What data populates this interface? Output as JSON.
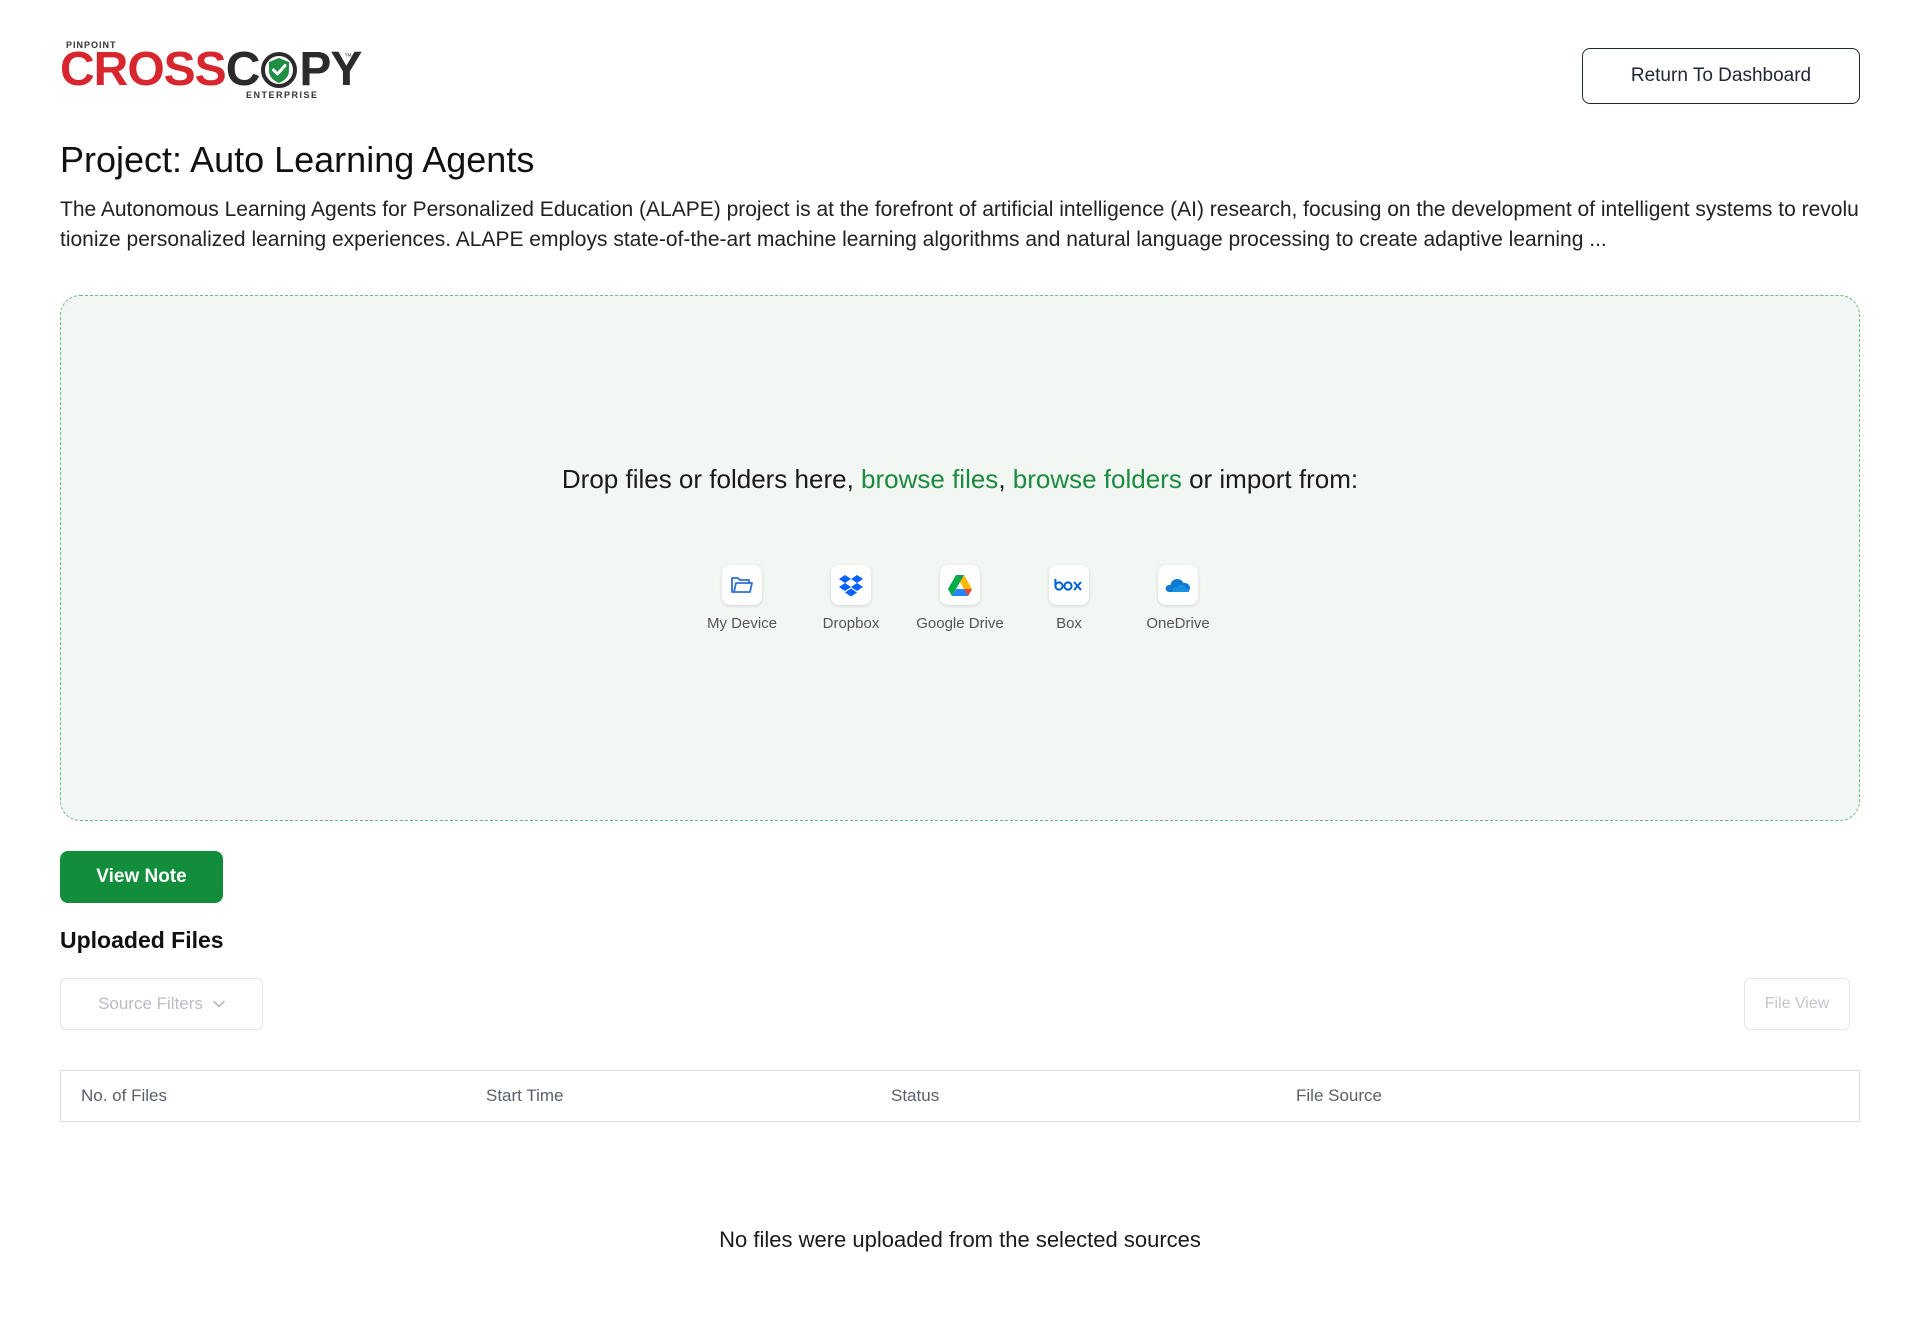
{
  "logo": {
    "top_text": "PINPOINT",
    "cross": "CROSS",
    "c": "C",
    "py": "PY",
    "bottom_text": "ENTERPRISE",
    "tm": "™"
  },
  "header": {
    "return_label": "Return To Dashboard"
  },
  "project": {
    "title": "Project: Auto Learning Agents",
    "description": "The Autonomous Learning Agents for Personalized Education (ALAPE) project is at the forefront of artificial intelligence (AI) research, focusing on the development of intelligent systems to revolutionize personalized learning experiences. ALAPE employs state-of-the-art machine learning algorithms and natural language processing to create adaptive learning ..."
  },
  "dropzone": {
    "text_before": "Drop files or folders here, ",
    "browse_files": "browse files",
    "comma": ", ",
    "browse_folders": "browse folders",
    "text_after": " or import from:",
    "sources": [
      {
        "label": "My Device",
        "icon": "folder-icon"
      },
      {
        "label": "Dropbox",
        "icon": "dropbox-icon"
      },
      {
        "label": "Google Drive",
        "icon": "google-drive-icon"
      },
      {
        "label": "Box",
        "icon": "box-icon"
      },
      {
        "label": "OneDrive",
        "icon": "onedrive-icon"
      }
    ]
  },
  "view_note_label": "View Note",
  "uploaded": {
    "title": "Uploaded Files",
    "source_filters_label": "Source Filters",
    "file_view_label": "File View",
    "columns": [
      "No. of Files",
      "Start Time",
      "Status",
      "File Source"
    ],
    "empty_message": "No files were uploaded from the selected sources"
  },
  "colors": {
    "accent_green": "#128d3c",
    "link_green": "#1c8a3f",
    "brand_red": "#d7262e"
  }
}
